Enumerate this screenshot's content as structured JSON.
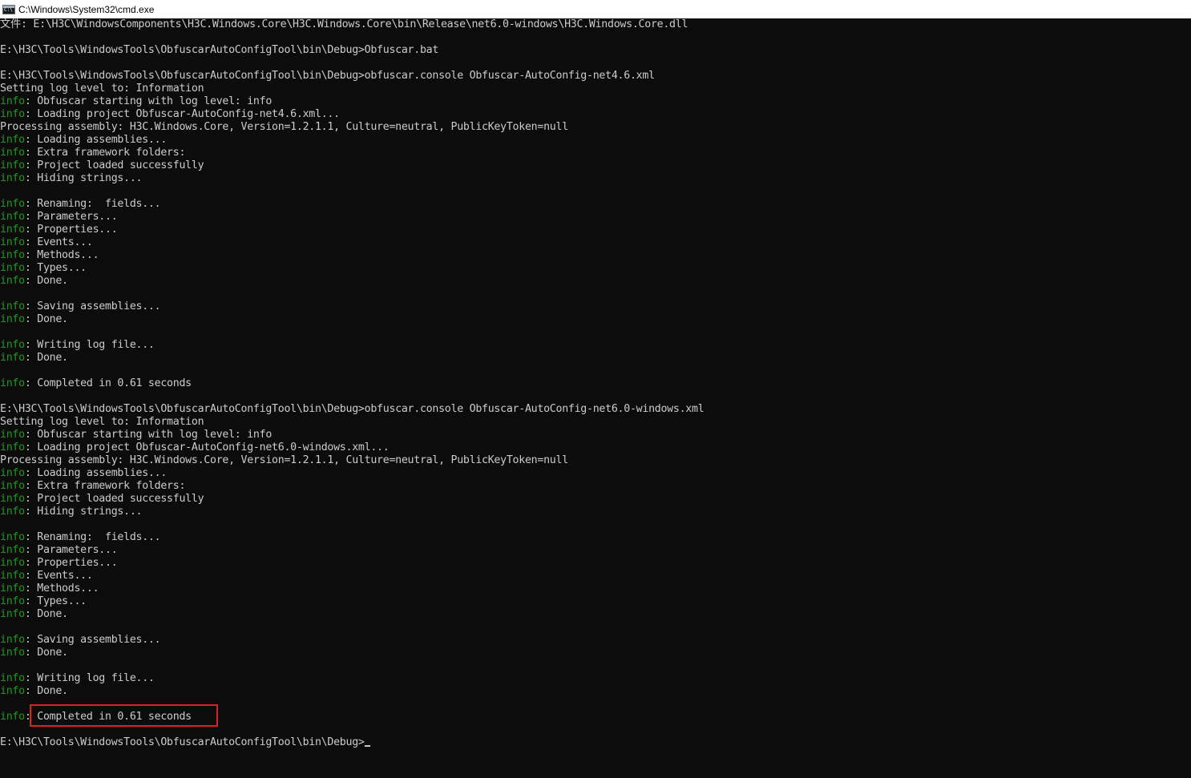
{
  "window": {
    "title": "C:\\Windows\\System32\\cmd.exe",
    "icon": "cmd-icon"
  },
  "console": {
    "tag_color": "#13a10e",
    "text_color": "#cccccc",
    "background": "#0c0c0c",
    "lines": [
      {
        "text": "文件: E:\\H3C\\WindowsComponents\\H3C.Windows.Core\\H3C.Windows.Core\\bin\\Release\\net6.0-windows\\H3C.Windows.Core.dll"
      },
      {
        "text": ""
      },
      {
        "text": "E:\\H3C\\Tools\\WindowsTools\\ObfuscarAutoConfigTool\\bin\\Debug>Obfuscar.bat"
      },
      {
        "text": ""
      },
      {
        "text": "E:\\H3C\\Tools\\WindowsTools\\ObfuscarAutoConfigTool\\bin\\Debug>obfuscar.console Obfuscar-AutoConfig-net4.6.xml"
      },
      {
        "text": "Setting log level to: Information"
      },
      {
        "tag": "info",
        "text": ": Obfuscar starting with log level: info"
      },
      {
        "tag": "info",
        "text": ": Loading project Obfuscar-AutoConfig-net4.6.xml..."
      },
      {
        "text": "Processing assembly: H3C.Windows.Core, Version=1.2.1.1, Culture=neutral, PublicKeyToken=null"
      },
      {
        "tag": "info",
        "text": ": Loading assemblies..."
      },
      {
        "tag": "info",
        "text": ": Extra framework folders:"
      },
      {
        "tag": "info",
        "text": ": Project loaded successfully"
      },
      {
        "tag": "info",
        "text": ": Hiding strings..."
      },
      {
        "text": ""
      },
      {
        "tag": "info",
        "text": ": Renaming:  fields..."
      },
      {
        "tag": "info",
        "text": ": Parameters..."
      },
      {
        "tag": "info",
        "text": ": Properties..."
      },
      {
        "tag": "info",
        "text": ": Events..."
      },
      {
        "tag": "info",
        "text": ": Methods..."
      },
      {
        "tag": "info",
        "text": ": Types..."
      },
      {
        "tag": "info",
        "text": ": Done."
      },
      {
        "text": ""
      },
      {
        "tag": "info",
        "text": ": Saving assemblies..."
      },
      {
        "tag": "info",
        "text": ": Done."
      },
      {
        "text": ""
      },
      {
        "tag": "info",
        "text": ": Writing log file..."
      },
      {
        "tag": "info",
        "text": ": Done."
      },
      {
        "text": ""
      },
      {
        "tag": "info",
        "text": ": Completed in 0.61 seconds"
      },
      {
        "text": ""
      },
      {
        "text": "E:\\H3C\\Tools\\WindowsTools\\ObfuscarAutoConfigTool\\bin\\Debug>obfuscar.console Obfuscar-AutoConfig-net6.0-windows.xml"
      },
      {
        "text": "Setting log level to: Information"
      },
      {
        "tag": "info",
        "text": ": Obfuscar starting with log level: info"
      },
      {
        "tag": "info",
        "text": ": Loading project Obfuscar-AutoConfig-net6.0-windows.xml..."
      },
      {
        "text": "Processing assembly: H3C.Windows.Core, Version=1.2.1.1, Culture=neutral, PublicKeyToken=null"
      },
      {
        "tag": "info",
        "text": ": Loading assemblies..."
      },
      {
        "tag": "info",
        "text": ": Extra framework folders:"
      },
      {
        "tag": "info",
        "text": ": Project loaded successfully"
      },
      {
        "tag": "info",
        "text": ": Hiding strings..."
      },
      {
        "text": ""
      },
      {
        "tag": "info",
        "text": ": Renaming:  fields..."
      },
      {
        "tag": "info",
        "text": ": Parameters..."
      },
      {
        "tag": "info",
        "text": ": Properties..."
      },
      {
        "tag": "info",
        "text": ": Events..."
      },
      {
        "tag": "info",
        "text": ": Methods..."
      },
      {
        "tag": "info",
        "text": ": Types..."
      },
      {
        "tag": "info",
        "text": ": Done."
      },
      {
        "text": ""
      },
      {
        "tag": "info",
        "text": ": Saving assemblies..."
      },
      {
        "tag": "info",
        "text": ": Done."
      },
      {
        "text": ""
      },
      {
        "tag": "info",
        "text": ": Writing log file..."
      },
      {
        "tag": "info",
        "text": ": Done."
      },
      {
        "text": ""
      },
      {
        "tag": "info",
        "text": ": Completed in 0.61 seconds"
      },
      {
        "text": ""
      },
      {
        "text": "E:\\H3C\\Tools\\WindowsTools\\ObfuscarAutoConfigTool\\bin\\Debug>",
        "cursor": true
      }
    ]
  }
}
